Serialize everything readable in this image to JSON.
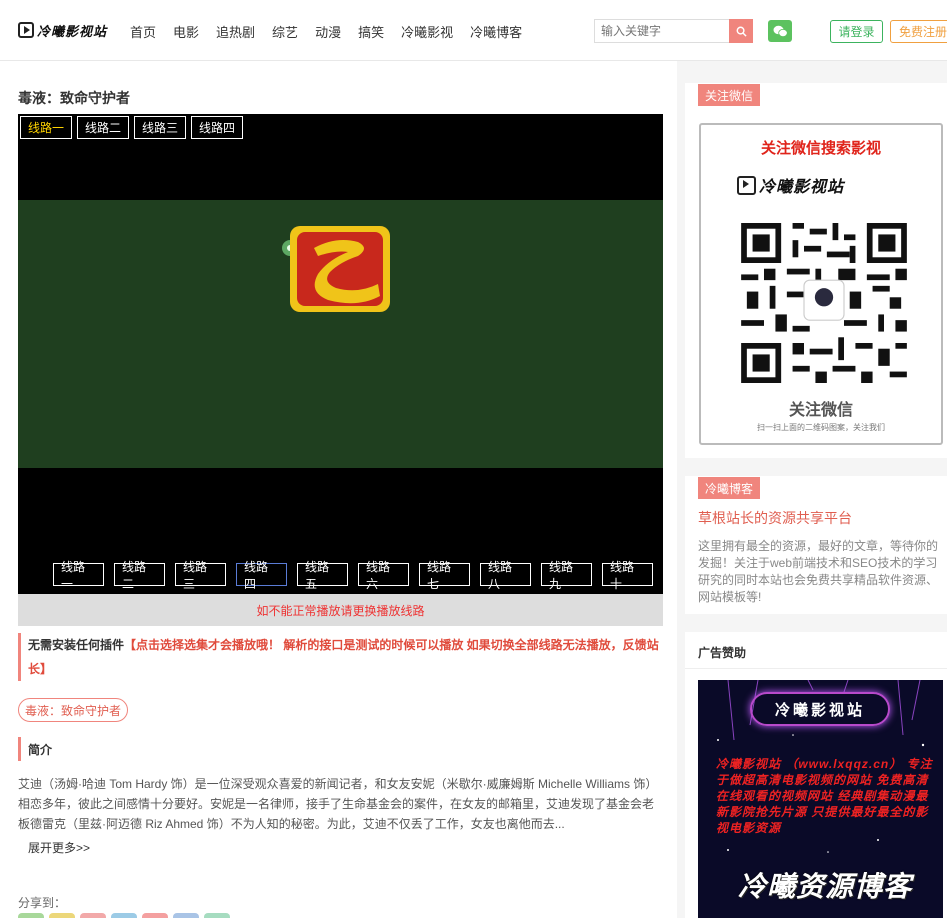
{
  "header": {
    "logo_text": "冷曦影视站",
    "nav": [
      "首页",
      "电影",
      "追热剧",
      "综艺",
      "动漫",
      "搞笑",
      "冷曦影视",
      "冷曦博客"
    ],
    "search_placeholder": "输入关键字",
    "login_label": "请登录",
    "register_label": "免费注册"
  },
  "main": {
    "title": "毒液：致命守护者",
    "player": {
      "top_lines": [
        "线路一",
        "线路二",
        "线路三",
        "线路四"
      ],
      "active_top_line": "线路一",
      "bottom_lines": [
        "线路一",
        "线路二",
        "线路三",
        "线路四",
        "线路五",
        "线路六",
        "线路七",
        "线路八",
        "线路九",
        "线路十"
      ],
      "highlighted_bottom_line": "线路四"
    },
    "notice": "如不能正常播放请更换播放线路",
    "tip_bold": "无需安装任何插件",
    "tip_red": "【点击选择选集才会播放哦！ 解析的接口是测试的时候可以播放 如果切换全部线路无法播放，反馈站长】",
    "tag": "毒液：致命守护者",
    "intro_heading": "简介",
    "description": "艾迪（汤姆·哈迪 Tom Hardy 饰）是一位深受观众喜爱的新闻记者，和女友安妮（米歇尔·威廉姆斯 Michelle Williams 饰）相恋多年，彼此之间感情十分要好。安妮是一名律师，接手了生命基金会的案件，在女友的邮箱里，艾迪发现了基金会老板德雷克（里兹·阿迈德 Riz Ahmed 饰）不为人知的秘密。为此，艾迪不仅丢了工作，女友也离他而去...",
    "more_label": "展开更多>>",
    "share_label": "分享到："
  },
  "sidebar": {
    "wechat": {
      "tag": "关注微信",
      "qr_title": "关注微信搜索影视",
      "qr_logo_text": "冷曦影视站",
      "qr_caption": "关注微信",
      "qr_small": "扫一扫上面的二维码图案，关注我们"
    },
    "blog": {
      "tag": "冷曦博客",
      "title": "草根站长的资源共享平台",
      "text": "这里拥有最全的资源，最好的文章，等待你的发掘！关注于web前端技术和SEO技术的学习研究的同时本站也会免费共享精品软件资源、网站模板等!"
    },
    "ad": {
      "heading": "广告赞助",
      "brand": "冷曦影视站",
      "text": "冷曦影视站 （www.lxqqz.cn） 专注于做超高清电影视频的网站 免费高清在线观看的视频网站 经典剧集动漫最新影院抢先片源 只提供最好最全的影视电影资源",
      "big": "冷曦资源博客"
    }
  },
  "colors": {
    "accent": "#f0857d",
    "login": "#3cb35e",
    "register": "#f0a040",
    "notice_red": "#ee3333"
  }
}
